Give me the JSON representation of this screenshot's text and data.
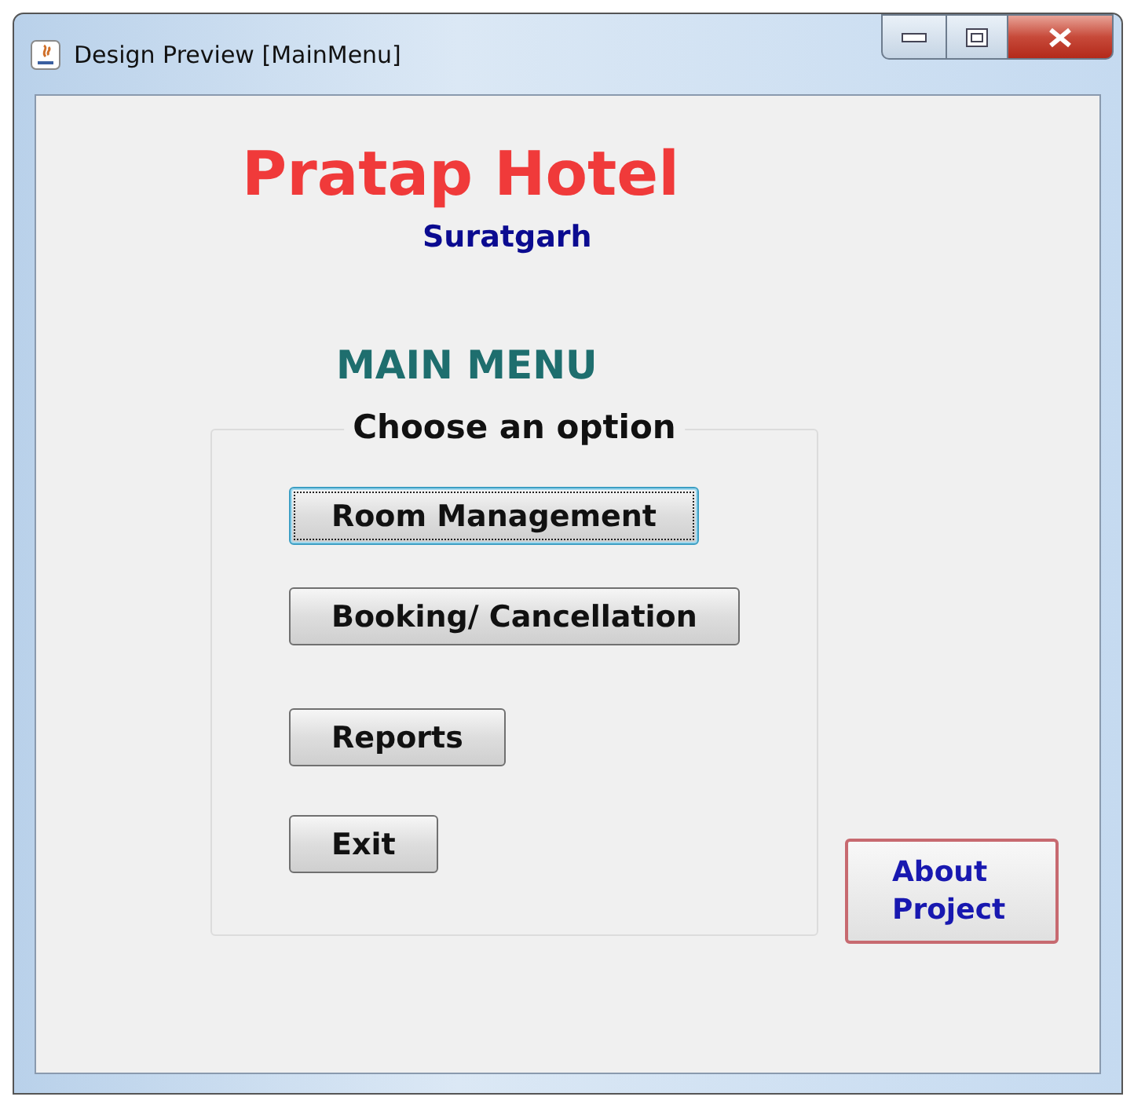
{
  "window": {
    "title": "Design Preview [MainMenu]"
  },
  "heading": "Pratap Hotel",
  "subtitle": "Suratgarh",
  "menu_title": "MAIN MENU",
  "option_group": {
    "title": "Choose an option",
    "buttons": [
      {
        "label": "Room Management",
        "focused": true
      },
      {
        "label": "Booking/ Cancellation",
        "focused": false
      },
      {
        "label": "Reports",
        "focused": false
      },
      {
        "label": "Exit",
        "focused": false
      }
    ]
  },
  "about_button": {
    "lines": [
      "About",
      "Project"
    ]
  }
}
